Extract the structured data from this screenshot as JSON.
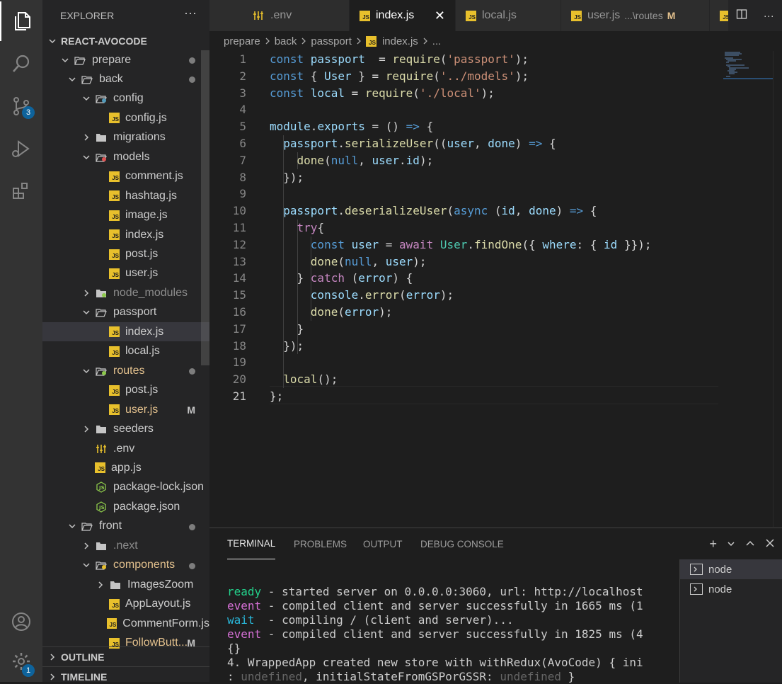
{
  "explorer": {
    "title": "EXPLORER",
    "more": "···",
    "project": "REACT-AVOCODE",
    "items": [
      {
        "label": "prepare",
        "type": "folder",
        "open": true,
        "depth": 1,
        "dot": true
      },
      {
        "label": "back",
        "type": "folder",
        "open": true,
        "depth": 2,
        "dot": true
      },
      {
        "label": "config",
        "type": "folder-config",
        "open": true,
        "depth": 3
      },
      {
        "label": "config.js",
        "type": "js",
        "depth": 4
      },
      {
        "label": "migrations",
        "type": "folder",
        "open": false,
        "depth": 3
      },
      {
        "label": "models",
        "type": "folder-models",
        "open": true,
        "depth": 3
      },
      {
        "label": "comment.js",
        "type": "js",
        "depth": 4
      },
      {
        "label": "hashtag.js",
        "type": "js",
        "depth": 4
      },
      {
        "label": "image.js",
        "type": "js",
        "depth": 4
      },
      {
        "label": "index.js",
        "type": "js",
        "depth": 4
      },
      {
        "label": "post.js",
        "type": "js",
        "depth": 4
      },
      {
        "label": "user.js",
        "type": "js",
        "depth": 4
      },
      {
        "label": "node_modules",
        "type": "folder-node",
        "open": false,
        "depth": 3,
        "dim": true
      },
      {
        "label": "passport",
        "type": "folder",
        "open": true,
        "depth": 3
      },
      {
        "label": "index.js",
        "type": "js",
        "depth": 4,
        "selected": true
      },
      {
        "label": "local.js",
        "type": "js",
        "depth": 4
      },
      {
        "label": "routes",
        "type": "folder-routes",
        "open": true,
        "depth": 3,
        "modified": true,
        "dot": true
      },
      {
        "label": "post.js",
        "type": "js",
        "depth": 4
      },
      {
        "label": "user.js",
        "type": "js",
        "depth": 4,
        "modified": true,
        "mark": "M"
      },
      {
        "label": "seeders",
        "type": "folder",
        "open": false,
        "depth": 3
      },
      {
        "label": ".env",
        "type": "env",
        "depth": 3
      },
      {
        "label": "app.js",
        "type": "js",
        "depth": 3
      },
      {
        "label": "package-lock.json",
        "type": "json",
        "depth": 3
      },
      {
        "label": "package.json",
        "type": "json",
        "depth": 3
      },
      {
        "label": "front",
        "type": "folder",
        "open": true,
        "depth": 2,
        "dot": true
      },
      {
        "label": ".next",
        "type": "folder-next",
        "open": false,
        "depth": 3,
        "dim": true
      },
      {
        "label": "components",
        "type": "folder-components",
        "open": true,
        "depth": 3,
        "modified": true,
        "dot": true
      },
      {
        "label": "ImagesZoom",
        "type": "folder",
        "open": false,
        "depth": 4
      },
      {
        "label": "AppLayout.js",
        "type": "js",
        "depth": 4
      },
      {
        "label": "CommentForm.js",
        "type": "js",
        "depth": 4
      },
      {
        "label": "FollowButt...",
        "type": "js",
        "depth": 4,
        "modified": true,
        "mark": "M"
      }
    ],
    "outline": "OUTLINE",
    "timeline": "TIMELINE"
  },
  "activity": {
    "scm_badge": "3",
    "settings_badge": "1"
  },
  "tabs": [
    {
      "label": ".env",
      "icon": "env"
    },
    {
      "label": "index.js",
      "icon": "js",
      "active": true,
      "close": "✕"
    },
    {
      "label": "local.js",
      "icon": "js"
    },
    {
      "label": "user.js",
      "icon": "js",
      "desc": "...\\routes",
      "mark": "M"
    },
    {
      "label": "",
      "icon": "js"
    }
  ],
  "breadcrumb": [
    "prepare",
    "back",
    "passport",
    "index.js",
    "..."
  ],
  "editor": {
    "lines": [
      [
        [
          "kw",
          "const "
        ],
        [
          "var",
          "passport"
        ],
        [
          "",
          "  = "
        ],
        [
          "fn",
          "require"
        ],
        [
          "",
          "("
        ],
        [
          "str",
          "'passport'"
        ],
        [
          "",
          ");"
        ]
      ],
      [
        [
          "kw",
          "const "
        ],
        [
          "",
          "{ "
        ],
        [
          "var",
          "User"
        ],
        [
          "",
          " } = "
        ],
        [
          "fn",
          "require"
        ],
        [
          "",
          "("
        ],
        [
          "str",
          "'../models'"
        ],
        [
          "",
          ");"
        ]
      ],
      [
        [
          "kw",
          "const "
        ],
        [
          "var",
          "local"
        ],
        [
          "",
          " = "
        ],
        [
          "fn",
          "require"
        ],
        [
          "",
          "("
        ],
        [
          "str",
          "'./local'"
        ],
        [
          "",
          ");"
        ]
      ],
      [],
      [
        [
          "var",
          "module"
        ],
        [
          "",
          "."
        ],
        [
          "var",
          "exports"
        ],
        [
          "",
          " = () "
        ],
        [
          "kw",
          "=>"
        ],
        [
          "",
          " {"
        ]
      ],
      [
        [
          "",
          "  "
        ],
        [
          "var",
          "passport"
        ],
        [
          "",
          "."
        ],
        [
          "fn",
          "serializeUser"
        ],
        [
          "",
          "(("
        ],
        [
          "var",
          "user"
        ],
        [
          "",
          ", "
        ],
        [
          "var",
          "done"
        ],
        [
          "",
          ") "
        ],
        [
          "kw",
          "=>"
        ],
        [
          "",
          " {"
        ]
      ],
      [
        [
          "",
          "    "
        ],
        [
          "fn",
          "done"
        ],
        [
          "",
          "("
        ],
        [
          "cst",
          "null"
        ],
        [
          "",
          ", "
        ],
        [
          "var",
          "user"
        ],
        [
          "",
          "."
        ],
        [
          "var",
          "id"
        ],
        [
          "",
          ");"
        ]
      ],
      [
        [
          "",
          "  });"
        ]
      ],
      [],
      [
        [
          "",
          "  "
        ],
        [
          "var",
          "passport"
        ],
        [
          "",
          "."
        ],
        [
          "fn",
          "deserializeUser"
        ],
        [
          "",
          "("
        ],
        [
          "kw",
          "async"
        ],
        [
          "",
          " ("
        ],
        [
          "var",
          "id"
        ],
        [
          "",
          ", "
        ],
        [
          "var",
          "done"
        ],
        [
          "",
          ") "
        ],
        [
          "kw",
          "=>"
        ],
        [
          "",
          " {"
        ]
      ],
      [
        [
          "",
          "    "
        ],
        [
          "kw2",
          "try"
        ],
        [
          "",
          "{"
        ]
      ],
      [
        [
          "",
          "      "
        ],
        [
          "kw",
          "const "
        ],
        [
          "var",
          "user"
        ],
        [
          "",
          " = "
        ],
        [
          "kw2",
          "await "
        ],
        [
          "cls",
          "User"
        ],
        [
          "",
          "."
        ],
        [
          "fn",
          "findOne"
        ],
        [
          "",
          "({ "
        ],
        [
          "var",
          "where"
        ],
        [
          "",
          ": { "
        ],
        [
          "var",
          "id"
        ],
        [
          "",
          " }});"
        ]
      ],
      [
        [
          "",
          "      "
        ],
        [
          "fn",
          "done"
        ],
        [
          "",
          "("
        ],
        [
          "cst",
          "null"
        ],
        [
          "",
          ", "
        ],
        [
          "var",
          "user"
        ],
        [
          "",
          ");"
        ]
      ],
      [
        [
          "",
          "    } "
        ],
        [
          "kw2",
          "catch"
        ],
        [
          "",
          " ("
        ],
        [
          "var",
          "error"
        ],
        [
          "",
          ") {"
        ]
      ],
      [
        [
          "",
          "      "
        ],
        [
          "var",
          "console"
        ],
        [
          "",
          "."
        ],
        [
          "fn",
          "error"
        ],
        [
          "",
          "("
        ],
        [
          "var",
          "error"
        ],
        [
          "",
          ");"
        ]
      ],
      [
        [
          "",
          "      "
        ],
        [
          "fn",
          "done"
        ],
        [
          "",
          "("
        ],
        [
          "var",
          "error"
        ],
        [
          "",
          ");"
        ]
      ],
      [
        [
          "",
          "    }"
        ]
      ],
      [
        [
          "",
          "  });"
        ]
      ],
      [],
      [
        [
          "",
          "  "
        ],
        [
          "fn",
          "local"
        ],
        [
          "",
          "();"
        ]
      ],
      [
        [
          "",
          "};"
        ]
      ]
    ],
    "current_line": 21
  },
  "panel": {
    "tabs": [
      "TERMINAL",
      "PROBLEMS",
      "OUTPUT",
      "DEBUG CONSOLE"
    ],
    "active_tab": "TERMINAL",
    "add": "+",
    "terminal_lines": [
      [
        [
          "t-green",
          "ready"
        ],
        [
          "",
          " - started server on 0.0.0.0:3060, url: http://localhost"
        ]
      ],
      [
        [
          "t-mag",
          "event"
        ],
        [
          "",
          " - compiled client and server successfully in 1665 ms (1"
        ]
      ],
      [
        [
          "t-cyan",
          "wait"
        ],
        [
          "",
          "  - compiling / (client and server)..."
        ]
      ],
      [
        [
          "t-mag",
          "event"
        ],
        [
          "",
          " - compiled client and server successfully in 1825 ms (4"
        ]
      ],
      [
        [
          "",
          "{}"
        ]
      ],
      [
        [
          "",
          "4. WrappedApp created new store with withRedux(AvoCode) { ini"
        ]
      ],
      [
        [
          "",
          ": "
        ],
        [
          "t-grey",
          "undefined"
        ],
        [
          "",
          ", initialStateFromGSPorGSSR: "
        ],
        [
          "t-grey",
          "undefined"
        ],
        [
          "",
          " }"
        ]
      ]
    ],
    "terminals": [
      {
        "label": "node",
        "selected": true
      },
      {
        "label": "node"
      }
    ]
  }
}
